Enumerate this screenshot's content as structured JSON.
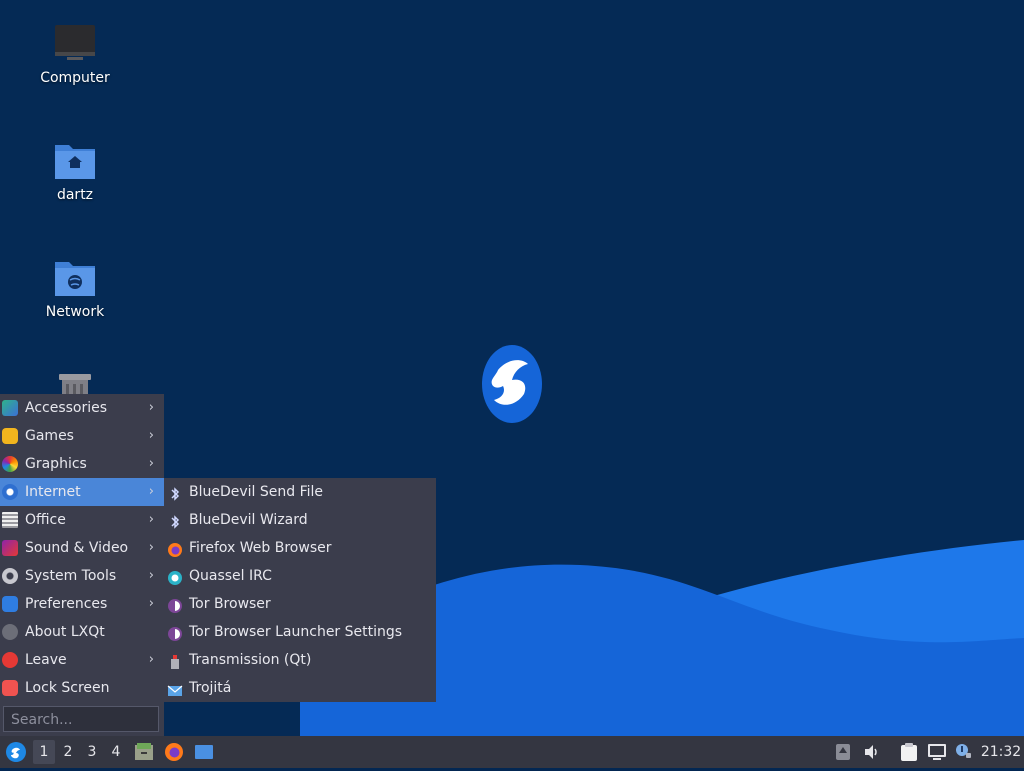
{
  "desktop": {
    "icons": [
      {
        "label": "Computer",
        "icon": "computer-icon"
      },
      {
        "label": "dartz",
        "icon": "home-folder-icon"
      },
      {
        "label": "Network",
        "icon": "network-folder-icon"
      },
      {
        "label": "",
        "icon": "trash-icon"
      }
    ],
    "wallpaper": {
      "logo": "lubuntu-bird-logo",
      "bg_color": "#052a55",
      "wave_color": "#1565d8",
      "wave_light_color": "#1e78ea"
    }
  },
  "start_menu": {
    "items": [
      {
        "label": "Accessories",
        "icon": "accessories-icon",
        "submenu": true
      },
      {
        "label": "Games",
        "icon": "games-icon",
        "submenu": true
      },
      {
        "label": "Graphics",
        "icon": "graphics-icon",
        "submenu": true
      },
      {
        "label": "Internet",
        "icon": "internet-icon",
        "submenu": true,
        "active": true
      },
      {
        "label": "Office",
        "icon": "office-icon",
        "submenu": true
      },
      {
        "label": "Sound & Video",
        "icon": "sound-video-icon",
        "submenu": true
      },
      {
        "label": "System Tools",
        "icon": "system-tools-icon",
        "submenu": true
      },
      {
        "label": "Preferences",
        "icon": "preferences-icon",
        "submenu": true
      },
      {
        "label": "About LXQt",
        "icon": "about-icon",
        "submenu": false
      },
      {
        "label": "Leave",
        "icon": "leave-icon",
        "submenu": true
      },
      {
        "label": "Lock Screen",
        "icon": "lock-icon",
        "submenu": false
      }
    ],
    "search_placeholder": "Search...",
    "arrow": "›"
  },
  "internet_submenu": {
    "items": [
      {
        "label": "BlueDevil Send File",
        "icon": "bluetooth-icon"
      },
      {
        "label": "BlueDevil Wizard",
        "icon": "bluetooth-icon"
      },
      {
        "label": "Firefox Web Browser",
        "icon": "firefox-icon"
      },
      {
        "label": "Quassel IRC",
        "icon": "quassel-icon"
      },
      {
        "label": "Tor Browser",
        "icon": "tor-icon"
      },
      {
        "label": "Tor Browser Launcher Settings",
        "icon": "tor-icon"
      },
      {
        "label": "Transmission (Qt)",
        "icon": "transmission-icon"
      },
      {
        "label": "Trojitá",
        "icon": "trojita-icon"
      }
    ]
  },
  "taskbar": {
    "desktops": [
      "1",
      "2",
      "3",
      "4"
    ],
    "current_desktop": "1",
    "clock": "21:32",
    "colors": {
      "accent": "#4a86d8",
      "panel": "#343641"
    }
  }
}
